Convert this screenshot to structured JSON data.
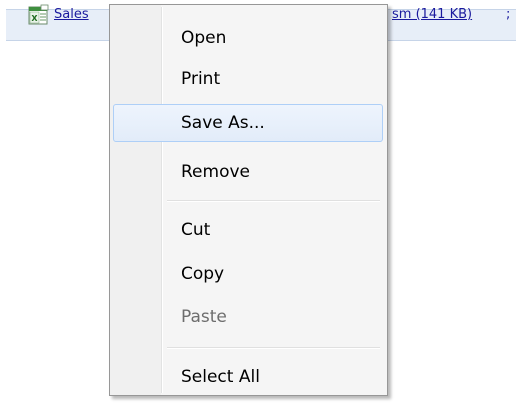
{
  "attachment": {
    "name_visible_left": "Sales",
    "name_visible_right": "sm (141 KB)",
    "separator": ";",
    "icon": "excel-file-icon"
  },
  "context_menu": {
    "items": [
      {
        "label": "Open",
        "enabled": true
      },
      {
        "label": "Print",
        "enabled": true
      },
      {
        "label": "Save As...",
        "enabled": true,
        "highlighted": true
      },
      {
        "label": "Remove",
        "enabled": true
      },
      {
        "label": "Cut",
        "enabled": true
      },
      {
        "label": "Copy",
        "enabled": true
      },
      {
        "label": "Paste",
        "enabled": false
      },
      {
        "label": "Select All",
        "enabled": true
      }
    ]
  },
  "colors": {
    "link": "#1a1a9e",
    "menu_background": "#f5f5f5",
    "hover_border": "#aecff7",
    "disabled_text": "#6d6d6d"
  }
}
